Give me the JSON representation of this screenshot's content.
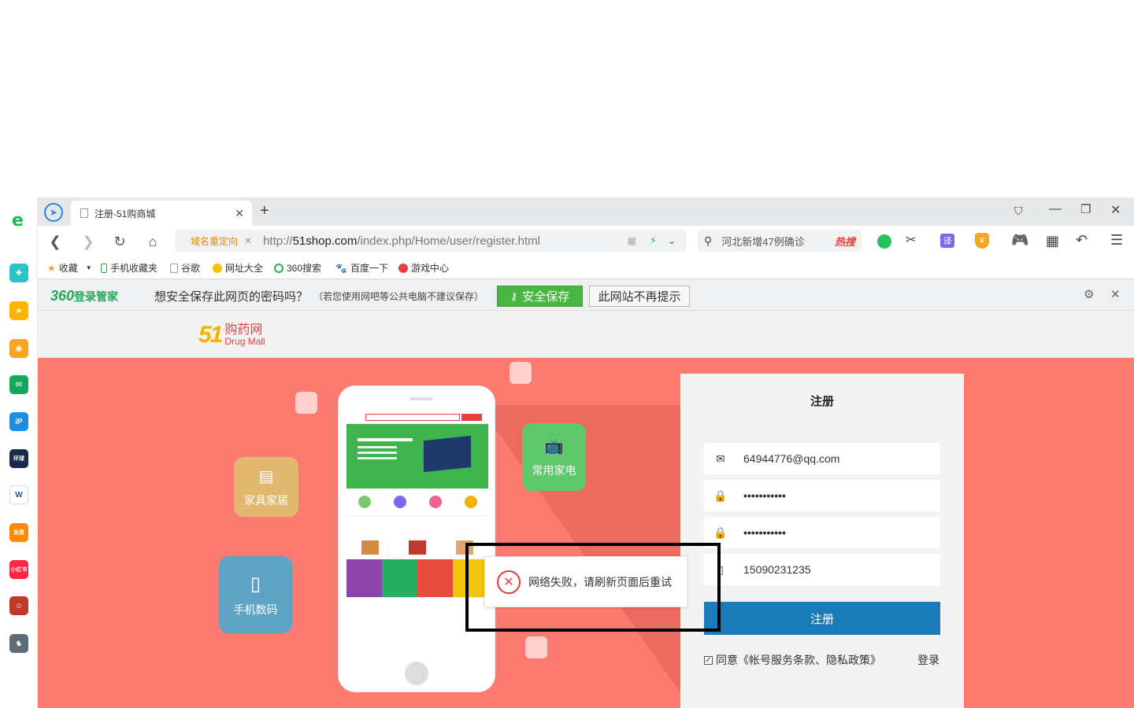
{
  "tab": {
    "title": "注册-51购商城"
  },
  "address": {
    "redirect_label": "域名重定向",
    "url_prefix": "http://",
    "url_host": "51shop.com",
    "url_path": "/index.php/Home/user/register.html"
  },
  "search": {
    "placeholder": "河北新增47例确诊",
    "hot_label": "热搜"
  },
  "bookmarks": [
    {
      "label": "收藏"
    },
    {
      "label": "手机收藏夹"
    },
    {
      "label": "谷歌"
    },
    {
      "label": "网址大全"
    },
    {
      "label": "360搜索"
    },
    {
      "label": "百度一下"
    },
    {
      "label": "游戏中心"
    }
  ],
  "password_bar": {
    "brand": "360",
    "brand_suffix": "登录管家",
    "prompt": "想安全保存此网页的密码吗？",
    "note": "（若您使用网吧等公共电脑不建议保存）",
    "save_label": "安全保存",
    "never_label": "此网站不再提示"
  },
  "site": {
    "logo_text": "购药网",
    "logo_sub": "Drug Mall",
    "logo_num": "51"
  },
  "hero": {
    "bubbles": [
      {
        "label": "家具家居"
      },
      {
        "label": "常用家电"
      },
      {
        "label": "手机数码"
      }
    ]
  },
  "register": {
    "title": "注册",
    "email": "64944776@qq.com",
    "password": "•••••••••••",
    "confirm": "•••••••••••",
    "phone": "15090231235",
    "submit_label": "注册",
    "agree_label": "同意《帐号服务条款、隐私政策》",
    "login_link": "登录"
  },
  "toast": {
    "message": "网络失败，请刷新页面后重试"
  },
  "colors": {
    "hero_bg": "#fd7a70",
    "primary_button": "#1a7bb9",
    "save_green": "#48b641",
    "toast_red": "#e33a3a"
  }
}
